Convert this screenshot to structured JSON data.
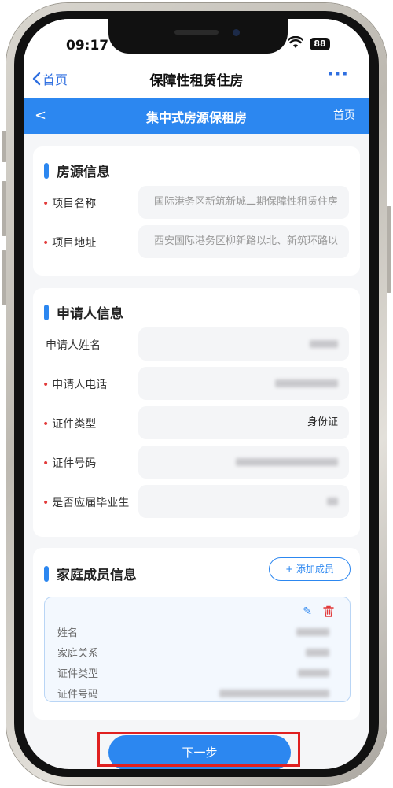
{
  "status_bar": {
    "time": "09:17",
    "battery": "88"
  },
  "nav": {
    "back_label": "首页",
    "title": "保障性租赁住房",
    "more": "···"
  },
  "header": {
    "back": "<",
    "title": "集中式房源保租房",
    "home_label": "首页"
  },
  "housing": {
    "title": "房源信息",
    "rows": [
      {
        "label": "项目名称",
        "required": "•",
        "value": "国际港务区新筑新城二期保障性租赁住房"
      },
      {
        "label": "项目地址",
        "required": "•",
        "value": "西安国际港务区柳新路以北、新筑环路以"
      }
    ]
  },
  "applicant": {
    "title": "申请人信息",
    "rows": [
      {
        "label": "申请人姓名",
        "required": ""
      },
      {
        "label": "申请人电话",
        "required": "•"
      },
      {
        "label": "证件类型",
        "required": "•",
        "value": "身份证"
      },
      {
        "label": "证件号码",
        "required": "•"
      },
      {
        "label": "是否应届毕业生",
        "required": "•"
      }
    ]
  },
  "family": {
    "title": "家庭成员信息",
    "add_button": "+ 添加成员",
    "fields": [
      "姓名",
      "家庭关系",
      "证件类型",
      "证件号码"
    ]
  },
  "footer": {
    "next_button": "下一步"
  },
  "colors": {
    "accent": "#2c87f0",
    "required": "#e23b3b",
    "highlight": "#e02020"
  }
}
